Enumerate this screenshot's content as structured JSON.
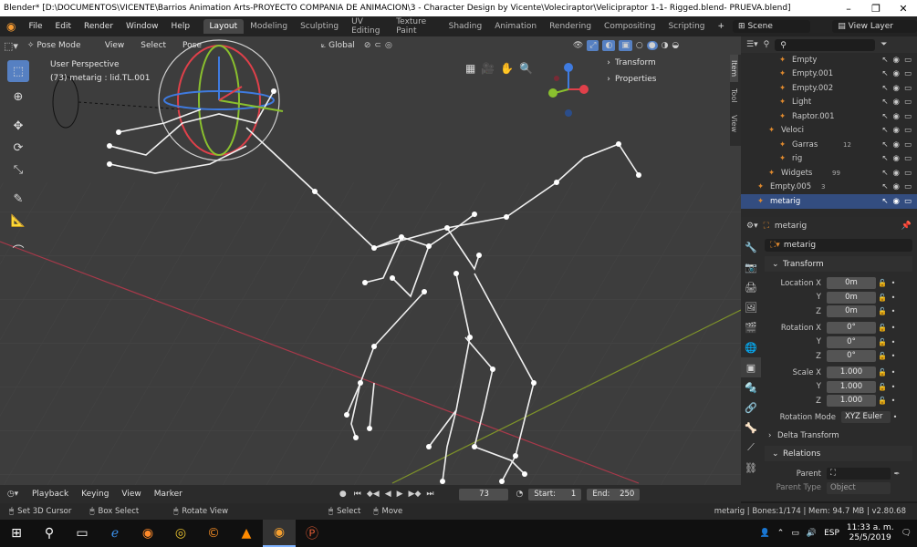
{
  "window": {
    "title": "Blender* [D:\\DOCUMENTOS\\VICENTE\\Barrios Animation Arts-PROYECTO COMPAÑIA DE ANIMACION\\3 - Character Design by Vicente\\Voleciraptor\\Velicipraptor 1-1- Rigged.blend- PRUEVA.blend]",
    "min": "–",
    "max": "❐",
    "close": "✕"
  },
  "menu": [
    "File",
    "Edit",
    "Render",
    "Window",
    "Help"
  ],
  "workspaces": [
    "Layout",
    "Modeling",
    "Sculpting",
    "UV Editing",
    "Texture Paint",
    "Shading",
    "Animation",
    "Rendering",
    "Compositing",
    "Scripting"
  ],
  "active_workspace": "Layout",
  "scene": {
    "label": "Scene",
    "view_layer": "View Layer"
  },
  "viewport_header": {
    "mode": "Pose Mode",
    "menus": [
      "View",
      "Select",
      "Pose"
    ],
    "orientation": "Global"
  },
  "viewport": {
    "perspective": "User Perspective",
    "active_info": "(73) metarig : lid.TL.001"
  },
  "sidebar_tabs": [
    "Item",
    "Tool",
    "View"
  ],
  "npanel": {
    "transform": "Transform",
    "properties": "Properties"
  },
  "outliner": {
    "items": [
      {
        "label": "Empty",
        "indent": 3
      },
      {
        "label": "Empty.001",
        "indent": 3
      },
      {
        "label": "Empty.002",
        "indent": 3
      },
      {
        "label": "Light",
        "indent": 3
      },
      {
        "label": "Raptor.001",
        "indent": 3
      },
      {
        "label": "Veloci",
        "indent": 2
      },
      {
        "label": "Garras",
        "indent": 3,
        "badge": "12"
      },
      {
        "label": "rig",
        "indent": 3
      },
      {
        "label": "Widgets",
        "indent": 2,
        "badge": "99"
      },
      {
        "label": "Empty.005",
        "indent": 1,
        "badge": "3"
      },
      {
        "label": "metarig",
        "indent": 1,
        "selected": true
      }
    ]
  },
  "properties": {
    "object_name": "metarig",
    "data_name": "metarig",
    "transform_label": "Transform",
    "location": {
      "label": "Location X",
      "x": "0m",
      "y": "0m",
      "z": "0m"
    },
    "rotation": {
      "label": "Rotation X",
      "x": "0°",
      "y": "0°",
      "z": "0°"
    },
    "scale": {
      "label": "Scale X",
      "x": "1.000",
      "y": "1.000",
      "z": "1.000"
    },
    "axis_y": "Y",
    "axis_z": "Z",
    "rotation_mode_label": "Rotation Mode",
    "rotation_mode": "XYZ Euler",
    "delta_transform": "Delta Transform",
    "relations": "Relations",
    "parent_label": "Parent",
    "parent_type_label": "Parent Type",
    "parent_type": "Object"
  },
  "timeline": {
    "menus": [
      "Playback",
      "Keying",
      "View",
      "Marker"
    ],
    "current_frame": "73",
    "start_label": "Start:",
    "start": "1",
    "end_label": "End:",
    "end": "250"
  },
  "status": {
    "hint1": "Set 3D Cursor",
    "hint2": "Box Select",
    "hint3": "Rotate View",
    "hint4": "Select",
    "hint5": "Move",
    "stats": "metarig | Bones:1/174 | Mem: 94.7 MB | v2.80.68"
  },
  "taskbar": {
    "lang": "ESP",
    "time": "11:33 a. m.",
    "date": "25/5/2019"
  },
  "colors": {
    "accent": "#5680c2",
    "viewport_bg": "#3d3d3d",
    "panel_bg": "#2a2a2a",
    "x_axis": "#c0404a",
    "y_axis": "#8ca12e"
  }
}
